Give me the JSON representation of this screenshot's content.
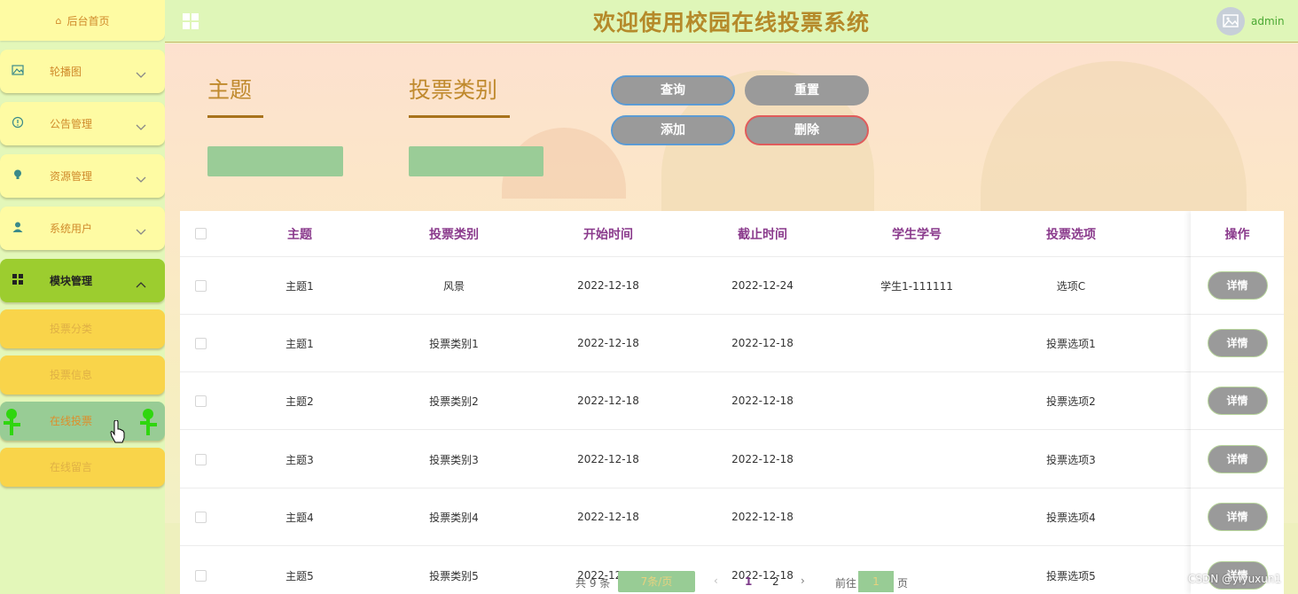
{
  "header": {
    "title": "欢迎使用校园在线投票系统",
    "username": "admin"
  },
  "sidebar": {
    "home": "后台首页",
    "items": [
      {
        "label": "轮播图",
        "icon": "image-icon"
      },
      {
        "label": "公告管理",
        "icon": "alert-circle-icon"
      },
      {
        "label": "资源管理",
        "icon": "lightbulb-icon"
      },
      {
        "label": "系统用户",
        "icon": "user-icon"
      },
      {
        "label": "模块管理",
        "icon": "grid-icon"
      }
    ],
    "sub_items": [
      {
        "label": "投票分类"
      },
      {
        "label": "投票信息"
      },
      {
        "label": "在线投票"
      },
      {
        "label": "在线留言"
      }
    ]
  },
  "search": {
    "field1_label": "主题",
    "field2_label": "投票类别",
    "query_btn": "查询",
    "reset_btn": "重置",
    "add_btn": "添加",
    "delete_btn": "删除"
  },
  "table": {
    "columns": [
      "主题",
      "投票类别",
      "开始时间",
      "截止时间",
      "学生学号",
      "投票选项",
      "操作"
    ],
    "rows": [
      {
        "topic": "主题1",
        "category": "风景",
        "start": "2022-12-18",
        "end": "2022-12-24",
        "student": "学生1-111111",
        "option": "选项C",
        "action": "详情"
      },
      {
        "topic": "主题1",
        "category": "投票类别1",
        "start": "2022-12-18",
        "end": "2022-12-18",
        "student": "",
        "option": "投票选项1",
        "action": "详情"
      },
      {
        "topic": "主题2",
        "category": "投票类别2",
        "start": "2022-12-18",
        "end": "2022-12-18",
        "student": "",
        "option": "投票选项2",
        "action": "详情"
      },
      {
        "topic": "主题3",
        "category": "投票类别3",
        "start": "2022-12-18",
        "end": "2022-12-18",
        "student": "",
        "option": "投票选项3",
        "action": "详情"
      },
      {
        "topic": "主题4",
        "category": "投票类别4",
        "start": "2022-12-18",
        "end": "2022-12-18",
        "student": "",
        "option": "投票选项4",
        "action": "详情"
      },
      {
        "topic": "主题5",
        "category": "投票类别5",
        "start": "2022-12-18",
        "end": "2022-12-18",
        "student": "",
        "option": "投票选项5",
        "action": "详情"
      }
    ]
  },
  "pagination": {
    "total": "共 9 条",
    "page_size": "7条/页",
    "prev": "‹",
    "page1": "1",
    "page2": "2",
    "next": "›",
    "goto": "前往",
    "jump_value": "1",
    "page_unit": "页"
  },
  "watermark": "CSDN @yiyuxun1",
  "colors": {
    "sidebar_item": "#fefba3",
    "sidebar_active": "#9ccd2f",
    "sub_item": "#f9d44a",
    "button_gray": "#9a9a9a",
    "header_title": "#b58a2a",
    "table_header": "#8a3a8c"
  }
}
